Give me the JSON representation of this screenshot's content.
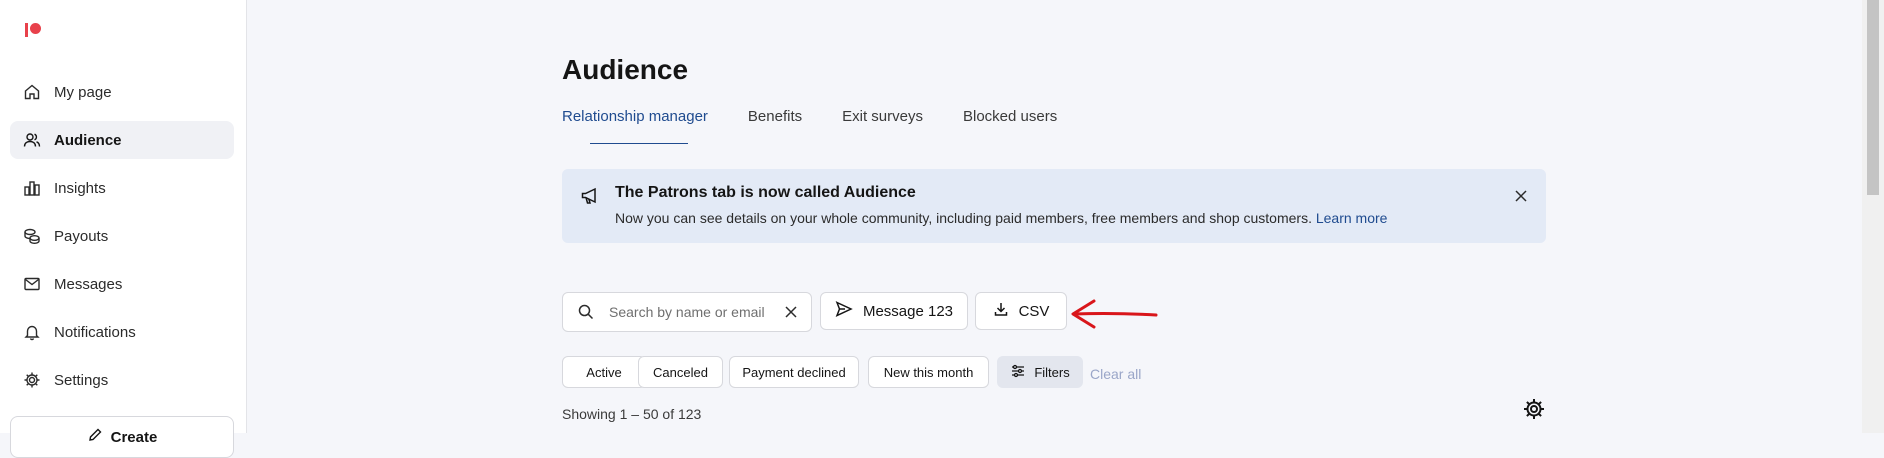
{
  "app": {
    "brand_color": "#e8414b",
    "accent_color": "#1f4b8f",
    "annotation_color": "#d9161b"
  },
  "sidebar": {
    "items": [
      {
        "label": "My page",
        "icon": "home-icon"
      },
      {
        "label": "Audience",
        "icon": "users-icon",
        "active": true
      },
      {
        "label": "Insights",
        "icon": "bar-chart-icon"
      },
      {
        "label": "Payouts",
        "icon": "coins-icon"
      },
      {
        "label": "Messages",
        "icon": "mail-icon"
      },
      {
        "label": "Notifications",
        "icon": "bell-icon"
      },
      {
        "label": "Settings",
        "icon": "gear-icon"
      }
    ],
    "create_label": "Create"
  },
  "page": {
    "title": "Audience"
  },
  "tabs": [
    {
      "label": "Relationship manager",
      "active": true
    },
    {
      "label": "Benefits"
    },
    {
      "label": "Exit surveys"
    },
    {
      "label": "Blocked users"
    }
  ],
  "banner": {
    "title": "The Patrons tab is now called Audience",
    "body": "Now you can see details on your whole community, including paid members, free members and shop customers.",
    "link": "Learn more"
  },
  "toolbar": {
    "search_placeholder": "Search by name or email",
    "message_label": "Message 123",
    "csv_label": "CSV"
  },
  "filters": {
    "chips": [
      "Active",
      "Canceled",
      "Payment declined",
      "New this month"
    ],
    "filters_label": "Filters",
    "clear_all": "Clear all"
  },
  "results": {
    "showing": "Showing 1 – 50 of 123"
  }
}
